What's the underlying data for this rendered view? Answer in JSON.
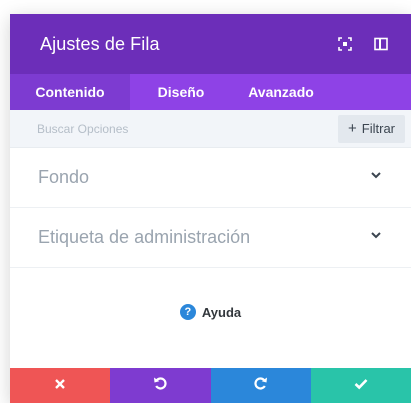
{
  "modal": {
    "title": "Ajustes de Fila",
    "header_icons": [
      "fullscreen-icon",
      "sidebar-toggle-icon"
    ]
  },
  "tabs": [
    {
      "label": "Contenido",
      "active": true
    },
    {
      "label": "Diseño",
      "active": false
    },
    {
      "label": "Avanzado",
      "active": false
    }
  ],
  "search": {
    "placeholder": "Buscar Opciones",
    "filter_label": "Filtrar"
  },
  "sections": [
    {
      "label": "Fondo",
      "icon": "chevron-down-icon"
    },
    {
      "label": "Etiqueta de administración",
      "icon": "chevron-down-icon"
    }
  ],
  "help": {
    "label": "Ayuda",
    "icon_glyph": "?"
  },
  "footer": {
    "buttons": [
      {
        "name": "discard",
        "icon": "close-icon",
        "color": "#ef5555"
      },
      {
        "name": "undo",
        "icon": "undo-icon",
        "color": "#7e3bd0"
      },
      {
        "name": "redo",
        "icon": "redo-icon",
        "color": "#2b87da"
      },
      {
        "name": "save",
        "icon": "check-icon",
        "color": "#29c4a9"
      }
    ]
  },
  "colors": {
    "header_bg": "#6c2eb9",
    "tabs_bg": "#8e42e6",
    "active_tab_bg": "#7d3bd1"
  }
}
